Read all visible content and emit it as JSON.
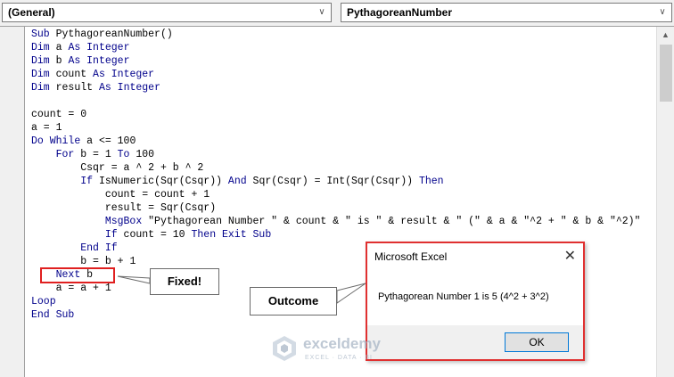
{
  "header": {
    "object_combo": "(General)",
    "procedure_combo": "PythagoreanNumber",
    "caret_glyph": "∨"
  },
  "code_lines": [
    "Sub PythagoreanNumber()",
    "Dim a As Integer",
    "Dim b As Integer",
    "Dim count As Integer",
    "Dim result As Integer",
    "",
    "count = 0",
    "a = 1",
    "Do While a <= 100",
    "    For b = 1 To 100",
    "        Csqr = a ^ 2 + b ^ 2",
    "        If IsNumeric(Sqr(Csqr)) And Sqr(Csqr) = Int(Sqr(Csqr)) Then",
    "            count = count + 1",
    "            result = Sqr(Csqr)",
    "            MsgBox \"Pythagorean Number \" & count & \" is \" & result & \" (\" & a & \"^2 + \" & b & \"^2)\"",
    "            If count = 10 Then Exit Sub",
    "        End If",
    "        b = b + 1",
    "    Next b",
    "    a = a + 1",
    "Loop",
    "End Sub"
  ],
  "annotations": {
    "fixed_label": "Fixed!",
    "outcome_label": "Outcome"
  },
  "dialog": {
    "title": "Microsoft Excel",
    "message": "Pythagorean Number 1 is 5 (4^2 + 3^2)",
    "ok_label": "OK",
    "close_glyph": "✕"
  },
  "scrollbar": {
    "up_glyph": "▲"
  },
  "watermark": {
    "name": "exceldemy",
    "tagline": "EXCEL · DATA · BI"
  },
  "colors": {
    "highlight_red": "#e02020",
    "keyword_blue": "#00008b",
    "ok_border": "#0078d7"
  }
}
